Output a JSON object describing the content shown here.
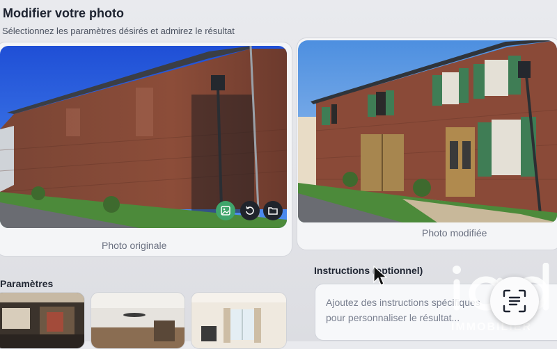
{
  "header": {
    "title": "Modifier votre photo",
    "subtitle": "Sélectionnez les paramètres désirés et admirez le résultat"
  },
  "original": {
    "caption": "Photo originale",
    "controls": [
      {
        "icon": "image-icon",
        "color": "#3fa56b"
      },
      {
        "icon": "rotate-icon",
        "color": "#20242c"
      },
      {
        "icon": "folder-icon",
        "color": "#20242c"
      }
    ]
  },
  "modified": {
    "caption": "Photo modifiée"
  },
  "parameters": {
    "label": "Paramètres",
    "presets": [
      {
        "name": "preset-dining-room"
      },
      {
        "name": "preset-living-room"
      },
      {
        "name": "preset-bedroom"
      }
    ]
  },
  "instructions": {
    "label": "Instructions (optionnel)",
    "placeholder": "Ajoutez des instructions spécifiques pour personnaliser le résultat..."
  },
  "watermark": {
    "brand": "IMMOBILIER",
    "logo_icon": "iad-logo"
  },
  "scan_button": {
    "icon": "scan-text-icon"
  },
  "colors": {
    "accent_green": "#3fa56b",
    "shutters_green": "#3f7d55",
    "brick": "#8a4a38"
  }
}
